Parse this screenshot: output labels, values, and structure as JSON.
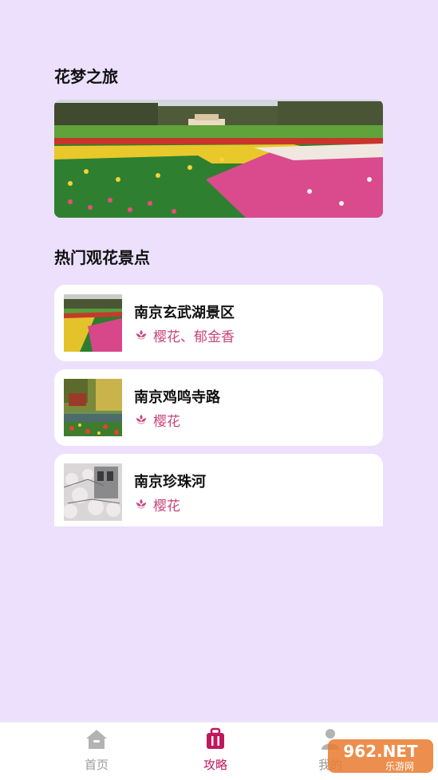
{
  "sections": {
    "title1": "花梦之旅",
    "title2": "热门观花景点"
  },
  "spots": [
    {
      "name": "南京玄武湖景区",
      "flowers": "樱花、郁金香"
    },
    {
      "name": "南京鸡鸣寺路",
      "flowers": "樱花"
    },
    {
      "name": "南京珍珠河",
      "flowers": "樱花"
    }
  ],
  "tabbar": {
    "home": "首页",
    "guide": "攻略",
    "me": "我的"
  },
  "watermark": {
    "text": "962.NET",
    "sub": "乐游网"
  },
  "colors": {
    "background": "#ece0fd",
    "accent": "#c0175d",
    "tag": "#c8447b",
    "inactive": "#999999"
  },
  "icons": {
    "tag": "flower-icon",
    "home": "home-icon",
    "guide": "suitcase-icon",
    "me": "person-icon"
  }
}
